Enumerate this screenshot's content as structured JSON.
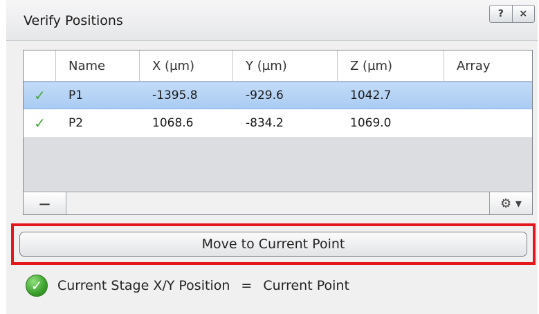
{
  "window": {
    "title": "Verify Positions",
    "help_label": "?",
    "close_label": "×"
  },
  "grid": {
    "columns": [
      "",
      "Name",
      "X (µm)",
      "Y (µm)",
      "Z (µm)",
      "Array"
    ],
    "rows": [
      {
        "status_icon": "checkmark-icon",
        "check": "✓",
        "name": "P1",
        "x": "-1395.8",
        "y": "-929.6",
        "z": "1042.7",
        "array": "",
        "selected": true
      },
      {
        "status_icon": "checkmark-icon",
        "check": "✓",
        "name": "P2",
        "x": "1068.6",
        "y": "-834.2",
        "z": "1069.0",
        "array": "",
        "selected": false
      }
    ],
    "footer": {
      "remove_label": "—",
      "settings_icon": "gear-icon",
      "settings_glyph": "⚙ ▾"
    }
  },
  "move_button": {
    "label": "Move to Current Point"
  },
  "status": {
    "icon": "check-circle-icon",
    "icon_glyph": "✓",
    "left_text": "Current Stage X/Y Position",
    "equals": "=",
    "right_text": "Current Point"
  },
  "colors": {
    "selected_row": "#b7d4f6",
    "highlight_border": "#e4171c",
    "check_green": "#46a83a"
  }
}
